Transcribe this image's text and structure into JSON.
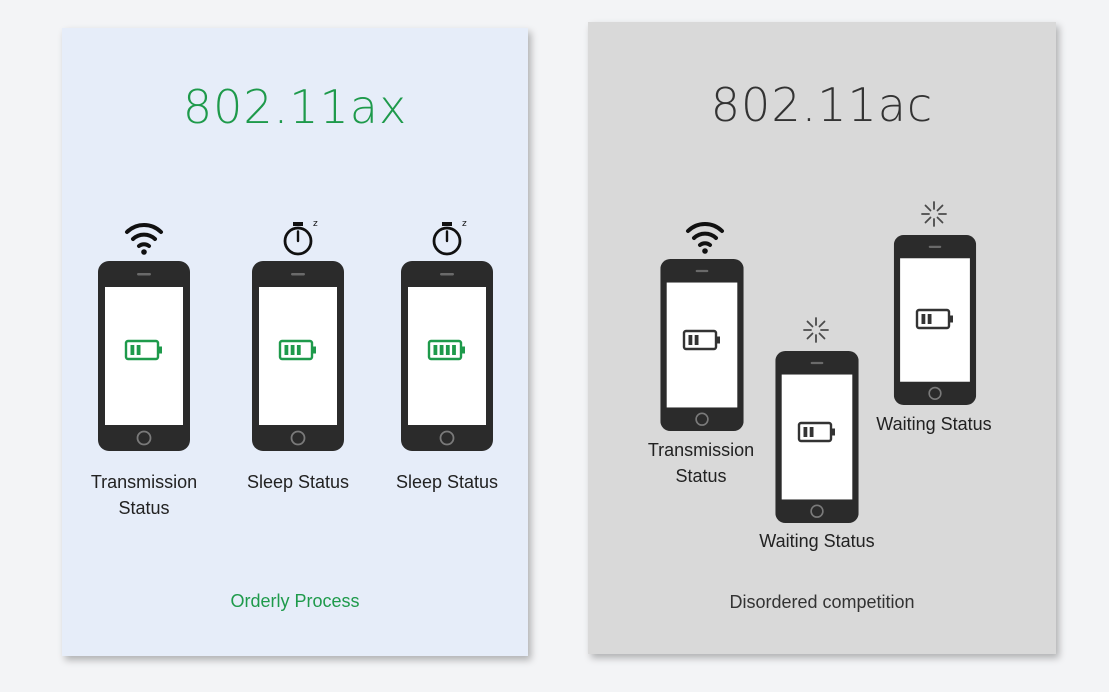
{
  "panels": {
    "ax": {
      "title": "802.11ax",
      "footer": "Orderly Process",
      "accent_color": "#1e9a4b",
      "devices": [
        {
          "label": "Transmission Status",
          "status_icon": "wifi-icon",
          "battery_level": 0.5
        },
        {
          "label": "Sleep Status",
          "status_icon": "stopwatch-sleep-icon",
          "battery_level": 0.75
        },
        {
          "label": "Sleep Status",
          "status_icon": "stopwatch-sleep-icon",
          "battery_level": 1.0
        }
      ]
    },
    "ac": {
      "title": "802.11ac",
      "footer": "Disordered competition",
      "accent_color": "#333333",
      "devices": [
        {
          "label": "Transmission Status",
          "status_icon": "wifi-icon",
          "battery_level": 0.5
        },
        {
          "label": "Waiting Status",
          "status_icon": "loading-spinner-icon",
          "battery_level": 0.5
        },
        {
          "label": "Waiting Status",
          "status_icon": "loading-spinner-icon",
          "battery_level": 0.5
        }
      ]
    }
  }
}
